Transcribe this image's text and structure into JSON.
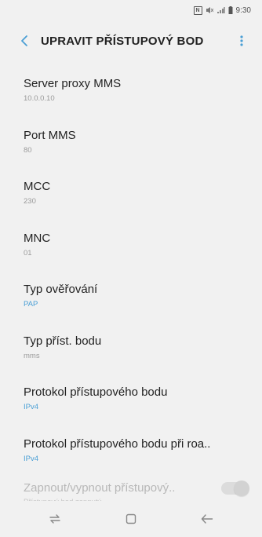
{
  "status_bar": {
    "time": "9:30",
    "icons": [
      "nfc-icon",
      "mute-icon",
      "signal-icon",
      "battery-icon"
    ]
  },
  "app_bar": {
    "title": "UPRAVIT PŘÍSTUPOVÝ BOD",
    "back_icon": "back-arrow-icon",
    "more_icon": "more-vert-icon"
  },
  "items": [
    {
      "title": "Server proxy MMS",
      "value": "10.0.0.10",
      "accent": false
    },
    {
      "title": "Port MMS",
      "value": "80",
      "accent": false
    },
    {
      "title": "MCC",
      "value": "230",
      "accent": false
    },
    {
      "title": "MNC",
      "value": "01",
      "accent": false
    },
    {
      "title": "Typ ověřování",
      "value": "PAP",
      "accent": true
    },
    {
      "title": "Typ příst. bodu",
      "value": "mms",
      "accent": false
    },
    {
      "title": "Protokol přístupového bodu",
      "value": "IPv4",
      "accent": true
    },
    {
      "title": "Protokol přístupového bodu při roa..",
      "value": "IPv4",
      "accent": true
    }
  ],
  "toggle_item": {
    "title": "Zapnout/vypnout přístupový..",
    "value": "Přístupový bod zapnutý",
    "enabled": false
  },
  "colors": {
    "background": "#f1f1f1",
    "accent": "#4a9fd5",
    "secondary_text": "#9a9a9a"
  },
  "nav_bar": {
    "icons": [
      "recent-apps-icon",
      "home-icon",
      "back-icon"
    ]
  }
}
